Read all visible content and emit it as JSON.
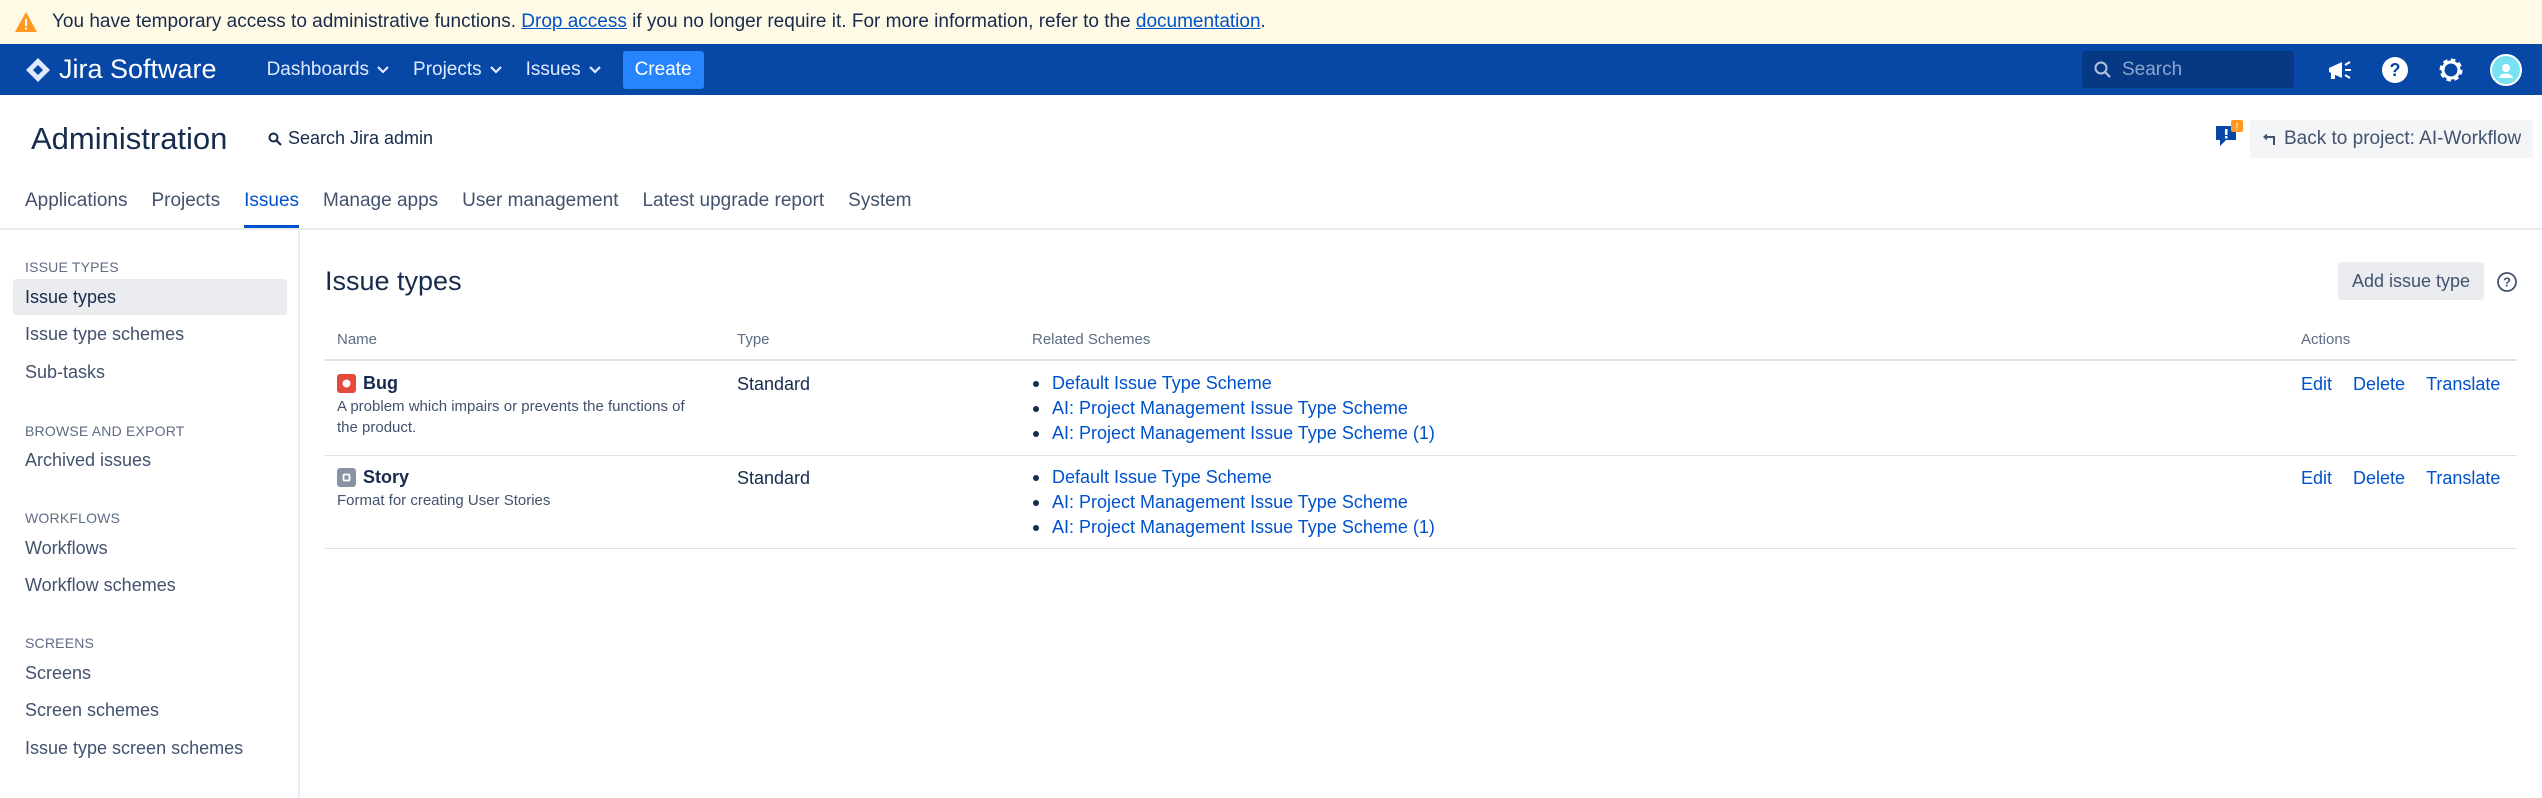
{
  "banner": {
    "text_before": "You have temporary access to administrative functions. ",
    "link1": "Drop access",
    "text_middle": " if you no longer require it. For more information, refer to the ",
    "link2": "documentation",
    "text_after": "."
  },
  "topnav": {
    "product": "Jira Software",
    "items": [
      {
        "label": "Dashboards"
      },
      {
        "label": "Projects"
      },
      {
        "label": "Issues"
      }
    ],
    "create_label": "Create",
    "search_placeholder": "Search",
    "icons": [
      "notifications-icon",
      "help-icon",
      "settings-icon",
      "avatar"
    ],
    "colors": {
      "bar": "#0747a6",
      "create": "#2684ff"
    }
  },
  "header": {
    "title": "Administration",
    "search_label": "Search Jira admin",
    "back_label": "Back to project: AI-Workflow",
    "feedback_badge": "!"
  },
  "tabs": [
    {
      "label": "Applications",
      "active": false
    },
    {
      "label": "Projects",
      "active": false
    },
    {
      "label": "Issues",
      "active": true
    },
    {
      "label": "Manage apps",
      "active": false
    },
    {
      "label": "User management",
      "active": false
    },
    {
      "label": "Latest upgrade report",
      "active": false
    },
    {
      "label": "System",
      "active": false
    }
  ],
  "sidebar": {
    "sections": [
      {
        "heading": "ISSUE TYPES",
        "items": [
          "Issue types",
          "Issue type schemes",
          "Sub-tasks"
        ]
      },
      {
        "heading": "BROWSE AND EXPORT",
        "items": [
          "Archived issues"
        ]
      },
      {
        "heading": "WORKFLOWS",
        "items": [
          "Workflows",
          "Workflow schemes"
        ]
      },
      {
        "heading": "SCREENS",
        "items": [
          "Screens",
          "Screen schemes",
          "Issue type screen schemes"
        ]
      }
    ],
    "active_item": "Issue types"
  },
  "main": {
    "title": "Issue types",
    "add_label": "Add issue type",
    "columns": [
      "Name",
      "Type",
      "Related Schemes",
      "Actions"
    ],
    "rows": [
      {
        "name": "Bug",
        "icon": "bug-icon",
        "icon_color": "#e5493a",
        "desc_lines": [
          "A problem which impairs or prevents the functions of",
          "the product."
        ],
        "type": "Standard",
        "schemes": [
          "Default Issue Type Scheme",
          "AI: Project Management Issue Type Scheme",
          "AI: Project Management Issue Type Scheme (1)"
        ],
        "actions": [
          "Edit",
          "Delete",
          "Translate"
        ]
      },
      {
        "name": "Story",
        "icon": "story-icon",
        "icon_color": "#8993a4",
        "desc_lines": [
          "Format for creating User Stories"
        ],
        "type": "Standard",
        "schemes": [
          "Default Issue Type Scheme",
          "AI: Project Management Issue Type Scheme",
          "AI: Project Management Issue Type Scheme (1)"
        ],
        "actions": [
          "Edit",
          "Delete",
          "Translate"
        ]
      }
    ]
  }
}
